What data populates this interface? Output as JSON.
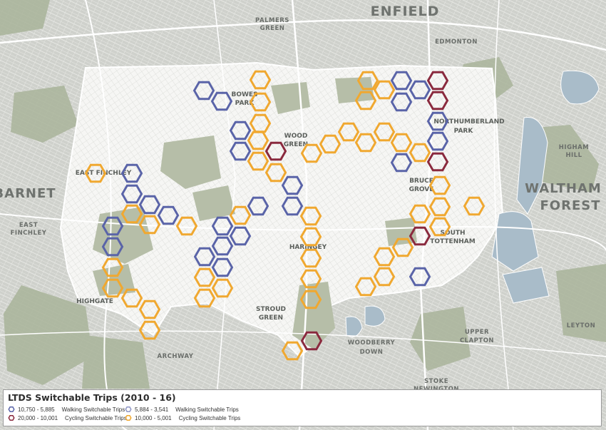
{
  "map": {
    "place_labels": {
      "enfield": "ENFIELD",
      "palmers_green": [
        "PALMERS",
        "GREEN"
      ],
      "edmonton": "EDMONTON",
      "bowes_park": [
        "BOWES",
        "PARK"
      ],
      "wood_green": [
        "WOOD",
        "GREEN"
      ],
      "northumberland_park": [
        "NORTHUMBERLAND",
        "PARK"
      ],
      "higham_hill": [
        "HIGHAM",
        "HILL"
      ],
      "east_finchley_top": "EAST FINCHLEY",
      "barnet": "BARNET",
      "bruce_grove": [
        "BRUCE",
        "GROVE"
      ],
      "waltham_forest": [
        "WALTHAM",
        "FOREST"
      ],
      "east_finchley": [
        "EAST",
        "FINCHLEY"
      ],
      "south_tottenham": [
        "SOUTH",
        "TOTTENHAM"
      ],
      "haringey": "HARINGEY",
      "highgate": "HIGHGATE",
      "stroud_green": [
        "STROUD",
        "GREEN"
      ],
      "upper_clapton": [
        "UPPER",
        "CLAPTON"
      ],
      "leyton": "LEYTON",
      "archway": "ARCHWAY",
      "woodberry_down": [
        "WOODBERRY",
        "DOWN"
      ],
      "stoke_newington": [
        "STOKE",
        "NEWINGTON"
      ]
    },
    "colors": {
      "walking_high": "#5a64a8",
      "walking_low": "#8f96c6",
      "cycling_high": "#8a2a3e",
      "cycling_low": "#f0a830"
    }
  },
  "legend": {
    "title": "LTDS Switchable Trips (2010 - 16)",
    "items": [
      {
        "range": "10,750 - 5,885",
        "label": "Walking Switchable Trips",
        "color": "#5a64a8"
      },
      {
        "range": "20,000 - 10,001",
        "label": "Cycling Switchable Trips",
        "color": "#8a2a3e"
      },
      {
        "range": "5,884 - 3,541",
        "label": "Walking Switchable Trips",
        "color": "#8f96c6"
      },
      {
        "range": "10,000 - 5,001",
        "label": "Cycling Switchable Trips",
        "color": "#f0a830"
      }
    ]
  }
}
